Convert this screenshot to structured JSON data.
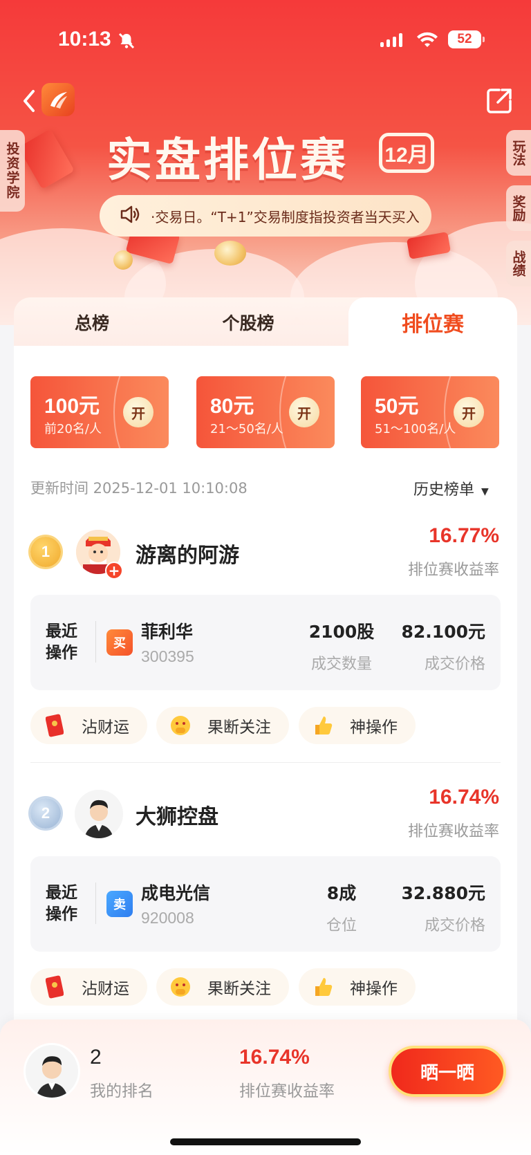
{
  "status_bar": {
    "time": "10:13",
    "battery": "52"
  },
  "banner": {
    "title": "实盘排位赛",
    "month": "12月",
    "ticker": "·交易日。“T+1”交易制度指投资者当天买入"
  },
  "side_left": "投资学院",
  "side_right": [
    "玩法",
    "奖励",
    "战绩"
  ],
  "tabs": [
    {
      "label": "总榜"
    },
    {
      "label": "个股榜"
    },
    {
      "label": "排位赛"
    }
  ],
  "prizes": [
    {
      "amount": "100元",
      "desc": "前20名/人",
      "open": "开"
    },
    {
      "amount": "80元",
      "desc": "21～50名/人",
      "open": "开"
    },
    {
      "amount": "50元",
      "desc": "51～100名/人",
      "open": "开"
    }
  ],
  "update_time": "更新时间 2025-12-01 10:10:08",
  "history_label": "历史榜单",
  "entries": [
    {
      "rank": "1",
      "name": "游离的阿游",
      "pct": "16.77%",
      "pct_label": "排位赛收益率",
      "op_title": "最近操作",
      "badge": "买",
      "badge_color": "#f5622e",
      "stock": "菲利华",
      "code": "300395",
      "mid_val": "2100股",
      "mid_label": "成交数量",
      "price": "82.100元",
      "price_label": "成交价格",
      "chips": [
        "沾财运",
        "果断关注",
        "神操作"
      ]
    },
    {
      "rank": "2",
      "name": "大狮控盘",
      "pct": "16.74%",
      "pct_label": "排位赛收益率",
      "op_title": "最近操作",
      "badge": "卖",
      "badge_color": "#2f8ef5",
      "stock": "成电光信",
      "code": "920008",
      "mid_val": "8成",
      "mid_label": "仓位",
      "price": "32.880元",
      "price_label": "成交价格",
      "chips": [
        "沾财运",
        "果断关注",
        "神操作"
      ]
    }
  ],
  "my": {
    "rank": "2",
    "rank_label": "我的排名",
    "pct": "16.74%",
    "pct_label": "排位赛收益率",
    "cta": "晒一晒"
  },
  "colors": {
    "accent": "#e8352a",
    "brand": "#f04c1f"
  }
}
